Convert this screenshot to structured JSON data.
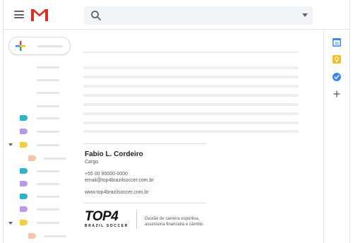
{
  "search": {
    "placeholder": ""
  },
  "signature": {
    "name": "Fabio L. Cordeiro",
    "title": "Cargo",
    "phone": "+55 00 90000-0000",
    "email": "email@top4brazilsoccer.com.br",
    "website": "www.top4brazilsoccer.com.br",
    "brand_logo": "TOP4",
    "brand_sub": "BRAZIL SOCCER",
    "tagline_line1": "Gestão de carreira esportiva,",
    "tagline_line2": "assessoria financeira e câmbio."
  },
  "icons": {
    "menu": "menu-icon",
    "logo": "gmail-logo-icon",
    "search": "search-icon",
    "calendar": "calendar-icon",
    "keep": "keep-icon",
    "tasks": "tasks-icon",
    "add": "add-icon",
    "compose": "compose-plus-icon"
  },
  "rail": {
    "calendar_day": "31"
  },
  "colors": {
    "label_teal": "#2bb5c8",
    "label_purple": "#b79be6",
    "label_yellow": "#f5cd3e",
    "label_peach": "#f6c3ad",
    "gmail_red": "#d93025",
    "calendar_blue": "#4285f4",
    "keep_yellow": "#f6bf26"
  }
}
